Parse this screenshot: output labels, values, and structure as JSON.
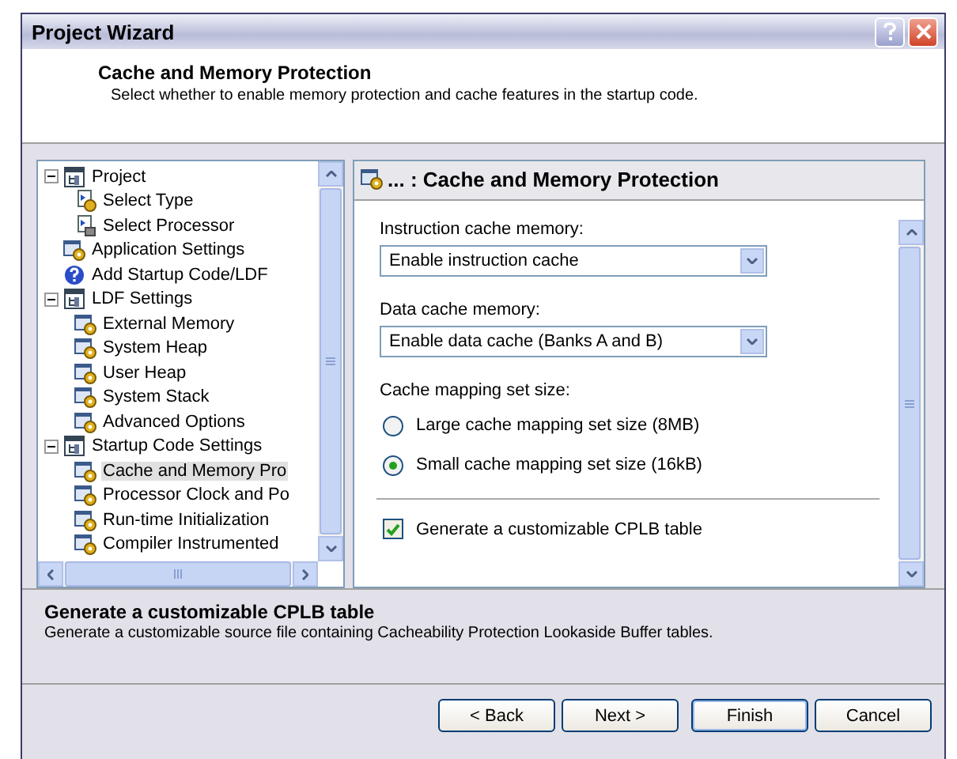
{
  "window": {
    "title": "Project Wizard"
  },
  "header": {
    "title": "Cache and Memory Protection",
    "subtitle": "Select whether to enable memory protection and cache features in the startup code."
  },
  "tree": [
    {
      "label": "Project",
      "kind": "group",
      "expanded": true,
      "selected": false,
      "children": [
        {
          "label": "Select Type",
          "kind": "step",
          "selected": false
        },
        {
          "label": "Select Processor",
          "kind": "chip",
          "selected": false
        }
      ]
    },
    {
      "label": "Application Settings",
      "kind": "page",
      "selected": false
    },
    {
      "label": "Add Startup Code/LDF",
      "kind": "help",
      "selected": false
    },
    {
      "label": "LDF Settings",
      "kind": "group",
      "expanded": true,
      "selected": false,
      "children": [
        {
          "label": "External Memory",
          "kind": "page",
          "selected": false
        },
        {
          "label": "System Heap",
          "kind": "page",
          "selected": false
        },
        {
          "label": "User Heap",
          "kind": "page",
          "selected": false
        },
        {
          "label": "System Stack",
          "kind": "page",
          "selected": false
        },
        {
          "label": "Advanced Options",
          "kind": "page",
          "selected": false
        }
      ]
    },
    {
      "label": "Startup Code Settings",
      "kind": "group",
      "expanded": true,
      "selected": false,
      "children": [
        {
          "label": "Cache and Memory Pro",
          "kind": "page",
          "selected": true
        },
        {
          "label": "Processor Clock and Po",
          "kind": "page",
          "selected": false
        },
        {
          "label": "Run-time Initialization",
          "kind": "page",
          "selected": false
        },
        {
          "label": "Compiler Instrumented",
          "kind": "page",
          "selected": false
        }
      ]
    }
  ],
  "panel": {
    "title": "... : Cache and Memory Protection",
    "fields": [
      {
        "kind": "dropdown",
        "label": "Instruction cache memory:",
        "value": "Enable instruction cache"
      },
      {
        "kind": "dropdown",
        "label": "Data cache memory:",
        "value": "Enable data cache (Banks A and B)"
      },
      {
        "kind": "radio",
        "label": "Cache mapping set size:",
        "options": [
          {
            "label": "Large cache mapping set size (8MB)",
            "selected": false
          },
          {
            "label": "Small cache mapping set size (16kB)",
            "selected": true
          }
        ]
      },
      {
        "kind": "divider"
      },
      {
        "kind": "checkbox",
        "label": "Generate a customizable CPLB table",
        "checked": true
      }
    ]
  },
  "description": {
    "title": "Generate a customizable CPLB table",
    "text": "Generate a customizable source file containing Cacheability Protection Lookaside Buffer tables."
  },
  "buttons": [
    {
      "label": "< Back",
      "default": false
    },
    {
      "label": "Next >",
      "default": false
    },
    {
      "label": "Finish",
      "default": true
    },
    {
      "label": "Cancel",
      "default": false
    }
  ]
}
